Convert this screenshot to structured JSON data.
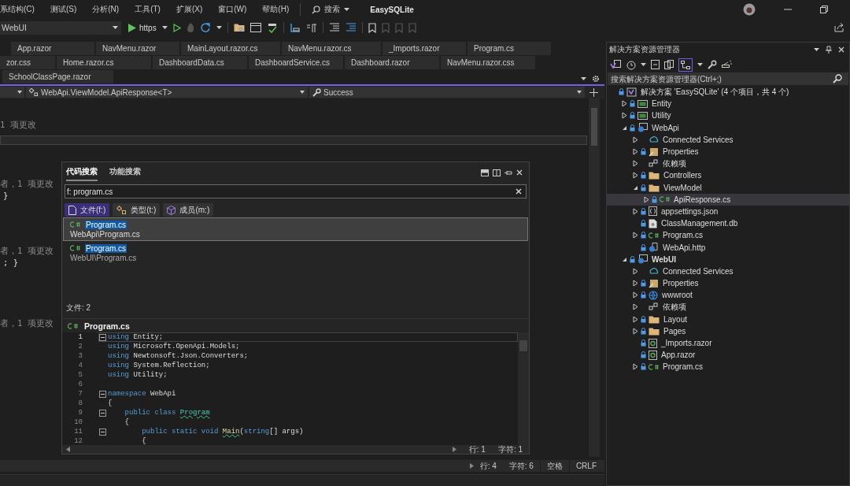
{
  "menu": {
    "items": [
      "系结构(C)",
      "测试(S)",
      "分析(N)",
      "工具(T)",
      "扩展(X)",
      "窗口(W)",
      "帮助(H)"
    ],
    "search": "搜索",
    "app_title": "EasySQLite"
  },
  "toolbar": {
    "project": "WebUI",
    "run_target": "https"
  },
  "tab_rows": [
    [
      {
        "label": "App.razor",
        "selected": false
      },
      {
        "label": "NavMenu.razor",
        "selected": false
      },
      {
        "label": "MainLayout.razor.cs",
        "selected": false
      },
      {
        "label": "NavMenu.razor.cs",
        "selected": false
      },
      {
        "label": "_Imports.razor",
        "selected": false
      },
      {
        "label": "Program.cs",
        "selected": false
      }
    ],
    [
      {
        "label": "zor.css",
        "selected": false
      },
      {
        "label": "Home.razor.cs",
        "selected": false
      },
      {
        "label": "DashboardData.cs",
        "selected": false
      },
      {
        "label": "DashboardService.cs",
        "selected": false
      },
      {
        "label": "Dashboard.razor",
        "selected": false
      },
      {
        "label": "NavMenu.razor.css",
        "selected": false
      }
    ],
    [
      {
        "label": "SchoolClassPage.razor",
        "selected": false
      }
    ]
  ],
  "nav_bar": {
    "type_scope": "WebApi.ViewModel.ApiResponse<T>",
    "member": "Success"
  },
  "editor": {
    "blocks": [
      [
        {
          "kind": "lens",
          "text": "1 项更改"
        }
      ],
      [
        {
          "kind": "lens",
          "text": "者，1 项更改"
        },
        {
          "kind": "code",
          "text": "}"
        }
      ],
      [
        {
          "kind": "lens",
          "text": "者，1 项更改"
        },
        {
          "kind": "code",
          "text": "; }"
        }
      ],
      [
        {
          "kind": "lens",
          "text": "者，1 项更改"
        }
      ]
    ]
  },
  "code_search": {
    "tabs": [
      {
        "label": "代码搜索",
        "selected": true
      },
      {
        "label": "功能搜索",
        "selected": false
      }
    ],
    "query": "f: program.cs",
    "filters": [
      {
        "label": "文件(f:)",
        "kind": "file",
        "selected": true
      },
      {
        "label": "类型(t:)",
        "kind": "type",
        "selected": false
      },
      {
        "label": "成员(m:)",
        "kind": "member",
        "selected": false
      }
    ],
    "results": [
      {
        "name": "Program.cs",
        "path": "WebApi\\Program.cs",
        "selected": true
      },
      {
        "name": "Program.cs",
        "path": "WebUI\\Program.cs",
        "selected": false
      }
    ],
    "count": "文件: 2",
    "preview": {
      "title": "Program.cs",
      "lines": [
        {
          "num": "1",
          "fold": true,
          "current": true,
          "tokens": [
            {
              "kind": "kw",
              "text": "using"
            },
            {
              "kind": "plain",
              "text": " Entity;"
            }
          ]
        },
        {
          "num": "2",
          "fold": false,
          "current": false,
          "tokens": [
            {
              "kind": "kw",
              "text": "using"
            },
            {
              "kind": "plain",
              "text": " Microsoft.OpenApi.Models;"
            }
          ]
        },
        {
          "num": "3",
          "fold": false,
          "current": false,
          "tokens": [
            {
              "kind": "kw",
              "text": "using"
            },
            {
              "kind": "plain",
              "text": " Newtonsoft.Json.Converters;"
            }
          ]
        },
        {
          "num": "4",
          "fold": false,
          "current": false,
          "tokens": [
            {
              "kind": "kw",
              "text": "using"
            },
            {
              "kind": "plain",
              "text": " System.Reflection;"
            }
          ]
        },
        {
          "num": "5",
          "fold": false,
          "current": false,
          "tokens": [
            {
              "kind": "kw",
              "text": "using"
            },
            {
              "kind": "plain",
              "text": " Utility;"
            }
          ]
        },
        {
          "num": "6",
          "fold": false,
          "current": false
        },
        {
          "num": "7",
          "fold": true,
          "current": false,
          "tokens": [
            {
              "kind": "kw",
              "text": "namespace"
            },
            {
              "kind": "plain",
              "text": " WebApi"
            }
          ]
        },
        {
          "num": "8",
          "fold": false,
          "current": false,
          "tokens": [
            {
              "kind": "plain",
              "text": "{"
            }
          ]
        },
        {
          "num": "9",
          "fold": true,
          "current": false,
          "tokens": [
            {
              "kind": "kw",
              "text": "    public class "
            },
            {
              "kind": "type",
              "text": "Program"
            }
          ]
        },
        {
          "num": "10",
          "fold": false,
          "current": false,
          "tokens": [
            {
              "kind": "plain",
              "text": "    {"
            }
          ]
        },
        {
          "num": "11",
          "fold": true,
          "current": false,
          "tokens": [
            {
              "kind": "kw",
              "text": "        public static void "
            },
            {
              "kind": "method",
              "text": "Main"
            },
            {
              "kind": "plain",
              "text": "("
            },
            {
              "kind": "kw",
              "text": "string"
            },
            {
              "kind": "plain",
              "text": "[] args)"
            }
          ]
        },
        {
          "num": "12",
          "fold": false,
          "current": false,
          "tokens": [
            {
              "kind": "plain",
              "text": "        {"
            }
          ]
        }
      ],
      "line": "行: 1",
      "char": "字符: 1"
    }
  },
  "status_bar": {
    "line": "行: 4",
    "char": "字符: 6",
    "indent": "空格",
    "line_ending": "CRLF"
  },
  "explorer": {
    "title": "解决方案资源管理器",
    "search_placeholder": "搜索解决方案资源管理器(Ctrl+;)",
    "tree": [
      {
        "label": "解决方案 'EasySQLite' (4 个项目，共 4 个)",
        "kind": "solution",
        "locked": true,
        "startup": false,
        "selected": false,
        "children": [
          {
            "label": "Entity",
            "kind": "lib",
            "locked": true,
            "startup": false,
            "selected": false,
            "expanded": false
          },
          {
            "label": "Utility",
            "kind": "lib",
            "locked": true,
            "startup": false,
            "selected": false,
            "expanded": false
          },
          {
            "label": "WebApi",
            "kind": "web",
            "locked": true,
            "startup": false,
            "selected": false,
            "expanded": true,
            "children": [
              {
                "label": "Connected Services",
                "kind": "connected",
                "locked": false,
                "startup": false,
                "selected": false,
                "expanded": false
              },
              {
                "label": "Properties",
                "kind": "properties",
                "locked": true,
                "startup": false,
                "selected": false,
                "expanded": false
              },
              {
                "label": "依赖项",
                "kind": "deps",
                "locked": false,
                "startup": false,
                "selected": false,
                "expanded": false
              },
              {
                "label": "Controllers",
                "kind": "folder",
                "locked": true,
                "startup": false,
                "selected": false,
                "expanded": false
              },
              {
                "label": "ViewModel",
                "kind": "folder",
                "locked": true,
                "startup": false,
                "selected": false,
                "expanded": true,
                "children": [
                  {
                    "label": "ApiResponse.cs",
                    "kind": "cs",
                    "locked": true,
                    "startup": false,
                    "selected": true,
                    "expanded": false
                  }
                ]
              },
              {
                "label": "appsettings.json",
                "kind": "json",
                "locked": true,
                "startup": false,
                "selected": false,
                "expanded": false
              },
              {
                "label": "ClassManagement.db",
                "kind": "db",
                "locked": true,
                "startup": false,
                "selected": false
              },
              {
                "label": "Program.cs",
                "kind": "cs",
                "locked": true,
                "startup": false,
                "selected": false,
                "expanded": false
              },
              {
                "label": "WebApi.http",
                "kind": "http",
                "locked": true,
                "startup": false,
                "selected": false
              }
            ]
          },
          {
            "label": "WebUI",
            "kind": "web",
            "locked": true,
            "startup": true,
            "selected": false,
            "expanded": true,
            "children": [
              {
                "label": "Connected Services",
                "kind": "connected",
                "locked": false,
                "startup": false,
                "selected": false,
                "expanded": false
              },
              {
                "label": "Properties",
                "kind": "properties",
                "locked": true,
                "startup": false,
                "selected": false,
                "expanded": false
              },
              {
                "label": "wwwroot",
                "kind": "globe",
                "locked": true,
                "startup": false,
                "selected": false,
                "expanded": false
              },
              {
                "label": "依赖项",
                "kind": "deps",
                "locked": false,
                "startup": false,
                "selected": false,
                "expanded": false
              },
              {
                "label": "Layout",
                "kind": "folder",
                "locked": true,
                "startup": false,
                "selected": false,
                "expanded": false
              },
              {
                "label": "Pages",
                "kind": "folder",
                "locked": true,
                "startup": false,
                "selected": false,
                "expanded": false
              },
              {
                "label": "_Imports.razor",
                "kind": "razor",
                "locked": true,
                "startup": false,
                "selected": false
              },
              {
                "label": "App.razor",
                "kind": "razor",
                "locked": true,
                "startup": false,
                "selected": false
              },
              {
                "label": "Program.cs",
                "kind": "cs",
                "locked": true,
                "startup": false,
                "selected": false,
                "expanded": false
              }
            ]
          }
        ]
      }
    ]
  }
}
